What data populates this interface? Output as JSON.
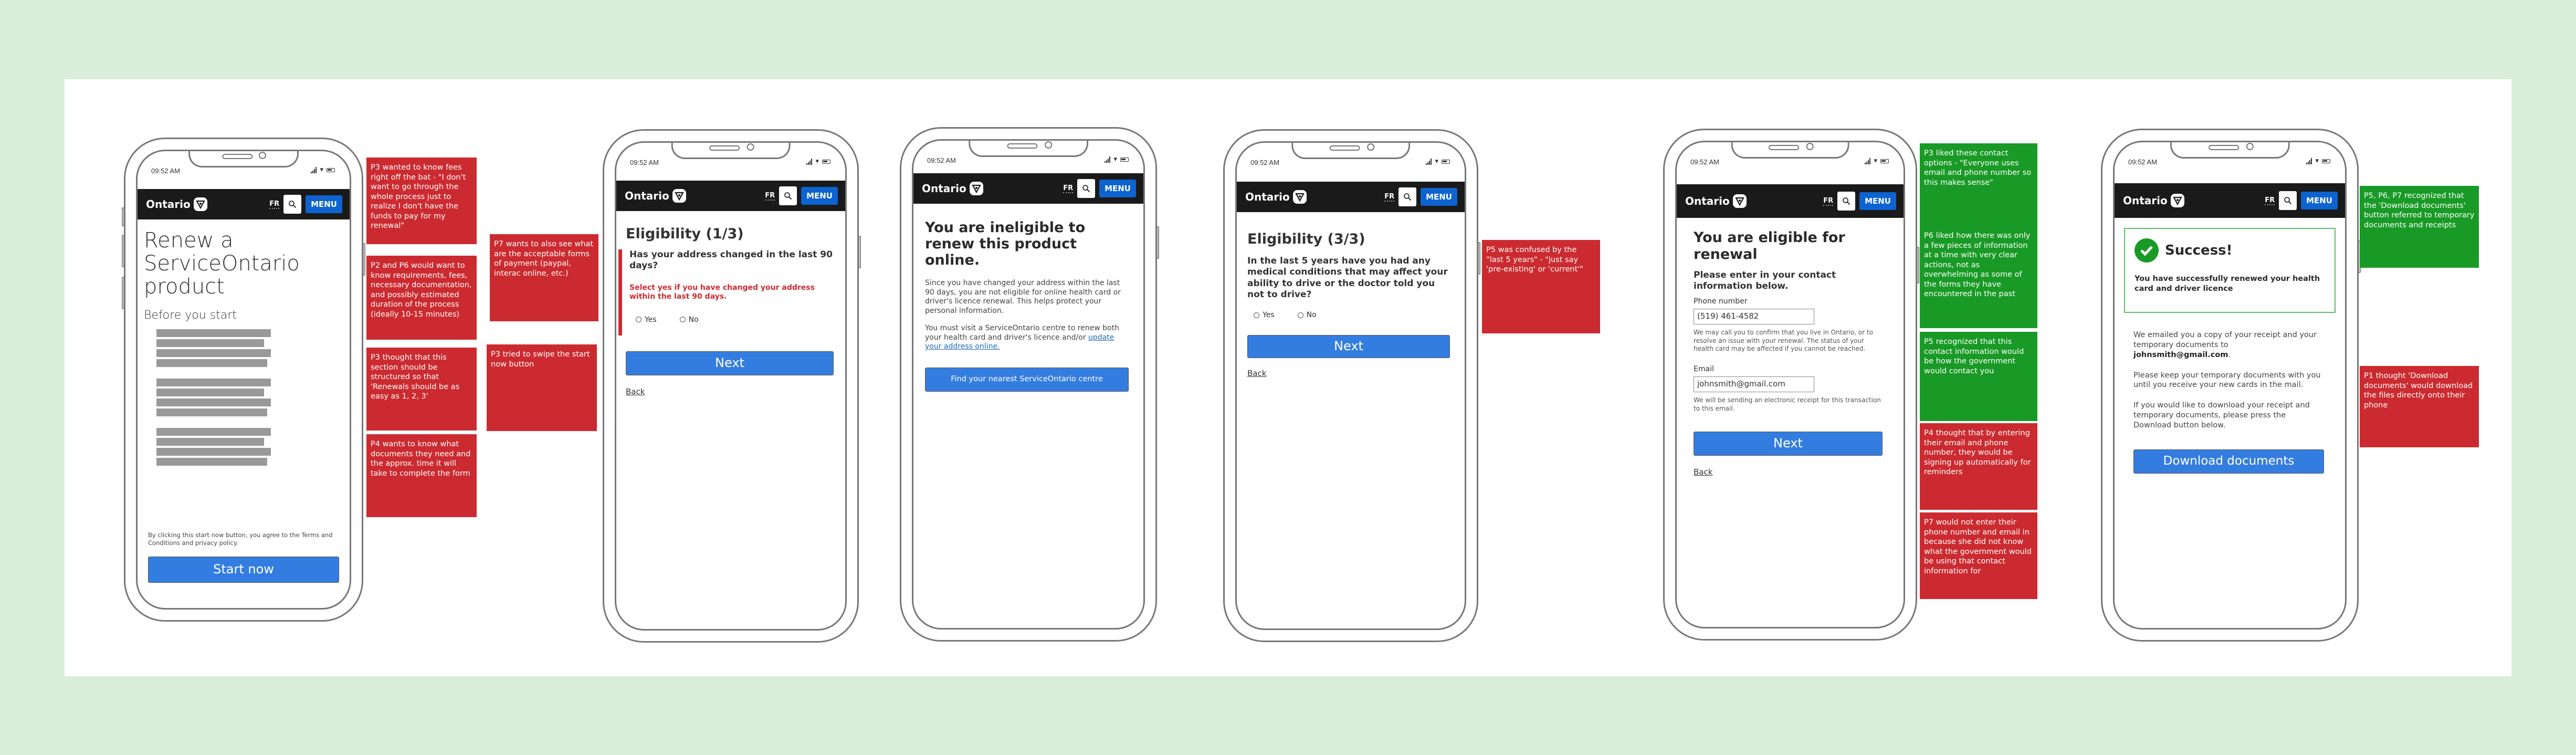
{
  "colors": {
    "canvas_bg": "#d9eed9",
    "board_bg": "#ffffff",
    "note_negative": "#cb2b30",
    "note_positive": "#199a26",
    "header_bg": "#1a1a1a",
    "menu_blue": "#0d63d0",
    "button_blue": "#347de0",
    "error_red": "#cb2b30",
    "success_green": "#199a26"
  },
  "common": {
    "status_time": "09:52 AM",
    "brand": "Ontario",
    "lang_toggle": "FR",
    "menu_label": "MENU",
    "search_icon": "search-icon",
    "logo_icon": "trillium-icon"
  },
  "screens": [
    {
      "id": "start",
      "title": "Renew a ServiceOntario product",
      "subtitle": "Before you start",
      "placeholder_paragraphs": 3,
      "terms_text": "By clicking this start now button, you agree to the Terms and Conditions and privacy policy.",
      "primary_button": "Start now"
    },
    {
      "id": "eligibility-1",
      "title": "Eligibility (1/3)",
      "question": "Has your address changed in the last 90 days?",
      "error": "Select yes if you have changed your address within the last 90 days.",
      "options": [
        "Yes",
        "No"
      ],
      "primary_button": "Next",
      "back_link": "Back"
    },
    {
      "id": "ineligible",
      "title": "You are ineligible to renew this product online.",
      "paragraph1": "Since you have changed your address within the last 90 days, you are not eligible for online health card or driver's licence renewal. This helps protect your personal information.",
      "paragraph2_prefix": "You must visit a ServiceOntario centre to renew both your health card and driver's licence and/or ",
      "paragraph2_link": "update your address online.",
      "primary_button": "Find your nearest ServiceOntario centre"
    },
    {
      "id": "eligibility-3",
      "title": "Eligibility (3/3)",
      "question": "In the last 5 years have you had any medical conditions that may affect your ability to drive or the doctor told you not to drive?",
      "options": [
        "Yes",
        "No"
      ],
      "primary_button": "Next",
      "back_link": "Back"
    },
    {
      "id": "eligible-contact",
      "title": "You are eligible for renewal",
      "subtitle": "Please enter in your contact information below.",
      "phone_label": "Phone number",
      "phone_value": "(519) 461-4582",
      "phone_hint": "We may call you to confirm that you live in Ontario, or to resolve an issue with your renewal. The status of your health card may be affected if you cannot be reached.",
      "email_label": "Email",
      "email_value": "johnsmith@gmail.com",
      "email_hint": "We will be sending an electronic receipt for this transaction to this email.",
      "primary_button": "Next",
      "back_link": "Back"
    },
    {
      "id": "success",
      "banner_title": "Success!",
      "banner_text": "You have successfully renewed your health card and driver licence",
      "paragraph1_prefix": "We emailed you a copy of your receipt and your temporary documents to ",
      "paragraph1_email": "johnsmith@gmail.com",
      "paragraph1_suffix": ".",
      "paragraph2": "Please keep your temporary documents with you until you receive your new cards in the mail.",
      "paragraph3": "If you would like to download your receipt and temporary documents, please press the Download button below.",
      "primary_button": "Download documents"
    }
  ],
  "notes": [
    {
      "screen": "start",
      "sentiment": "negative",
      "text": "P3 wanted to know fees right off the bat - \"I don't want to go through the whole process just to realize I don't have the funds to pay for my renewal\""
    },
    {
      "screen": "start",
      "sentiment": "negative",
      "text": "P2 and P6 would want to know requirements, fees, necessary documentation, and possibly estimated duration of the process (ideally 10-15 minutes)"
    },
    {
      "screen": "start",
      "sentiment": "negative",
      "text": "P3 thought that this section should be structured so that 'Renewals should be as easy as 1, 2, 3'"
    },
    {
      "screen": "start",
      "sentiment": "negative",
      "text": "P4 wants to know what documents they need and the approx. time it will take to complete the form"
    },
    {
      "screen": "start",
      "sentiment": "negative",
      "text": "P7 wants to also see what are the acceptable forms of payment (paypal, interac online, etc.)"
    },
    {
      "screen": "start",
      "sentiment": "negative",
      "text": "P3 tried to swipe the start now button"
    },
    {
      "screen": "eligibility-3",
      "sentiment": "negative",
      "text": "P5 was confused by the \"last 5 years\" - \"just say 'pre-existing' or 'current'\""
    },
    {
      "screen": "eligible-contact",
      "sentiment": "positive",
      "text": "P3 liked these contact options - \"Everyone uses email and phone number so this makes sense\""
    },
    {
      "screen": "eligible-contact",
      "sentiment": "positive",
      "text": "P6 liked how there was only a few pieces of information at a time with very clear actions, not as overwhelming as some of the forms they have encountered in the past"
    },
    {
      "screen": "eligible-contact",
      "sentiment": "positive",
      "text": "P5 recognized that this contact information would be how the government would contact you"
    },
    {
      "screen": "eligible-contact",
      "sentiment": "negative",
      "text": "P4 thought that by entering their email and phone number, they would be signing up automatically for reminders"
    },
    {
      "screen": "eligible-contact",
      "sentiment": "negative",
      "text": "P7 would not enter their phone number and email in because she did not know what the government would be using that contact information for"
    },
    {
      "screen": "success",
      "sentiment": "positive",
      "text": "P5, P6, P7 recognized that the 'Download documents' button referred to temporary documents and receipts"
    },
    {
      "screen": "success",
      "sentiment": "negative",
      "text": "P1 thought 'Download documents' would download the files directly onto their phone"
    }
  ]
}
